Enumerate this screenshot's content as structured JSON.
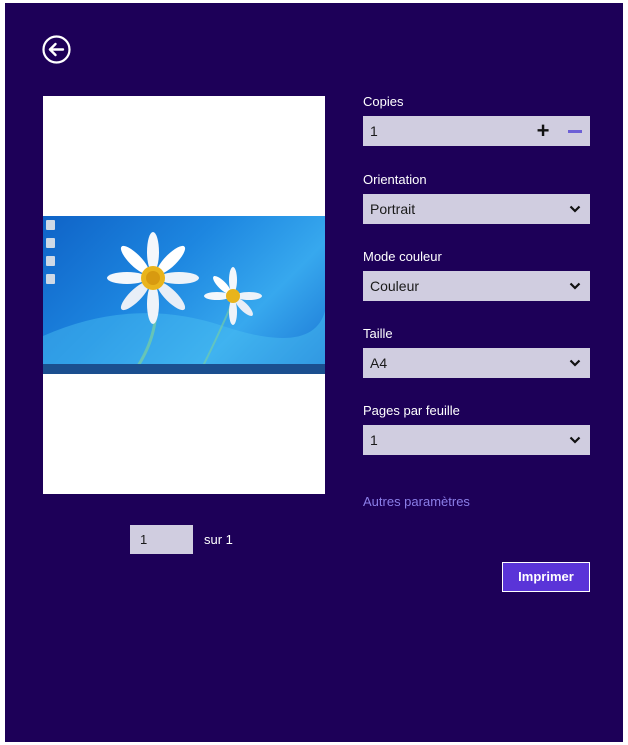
{
  "header": {
    "back_icon": "back-arrow-circle-icon"
  },
  "settings": {
    "copies": {
      "label": "Copies",
      "value": "1",
      "plus_label": "+",
      "minus_icon": "minus-icon"
    },
    "orientation": {
      "label": "Orientation",
      "value": "Portrait"
    },
    "color_mode": {
      "label": "Mode couleur",
      "value": "Couleur"
    },
    "size": {
      "label": "Taille",
      "value": "A4"
    },
    "pages_per_sheet": {
      "label": "Pages par feuille",
      "value": "1"
    },
    "more_settings": "Autres paramètres"
  },
  "pager": {
    "current_page": "1",
    "of_total": "sur 1"
  },
  "actions": {
    "print_label": "Imprimer"
  },
  "colors": {
    "background": "#1d0058",
    "field": "#d0cde0",
    "accent": "#5a34d8",
    "link": "#8b7ee8"
  }
}
